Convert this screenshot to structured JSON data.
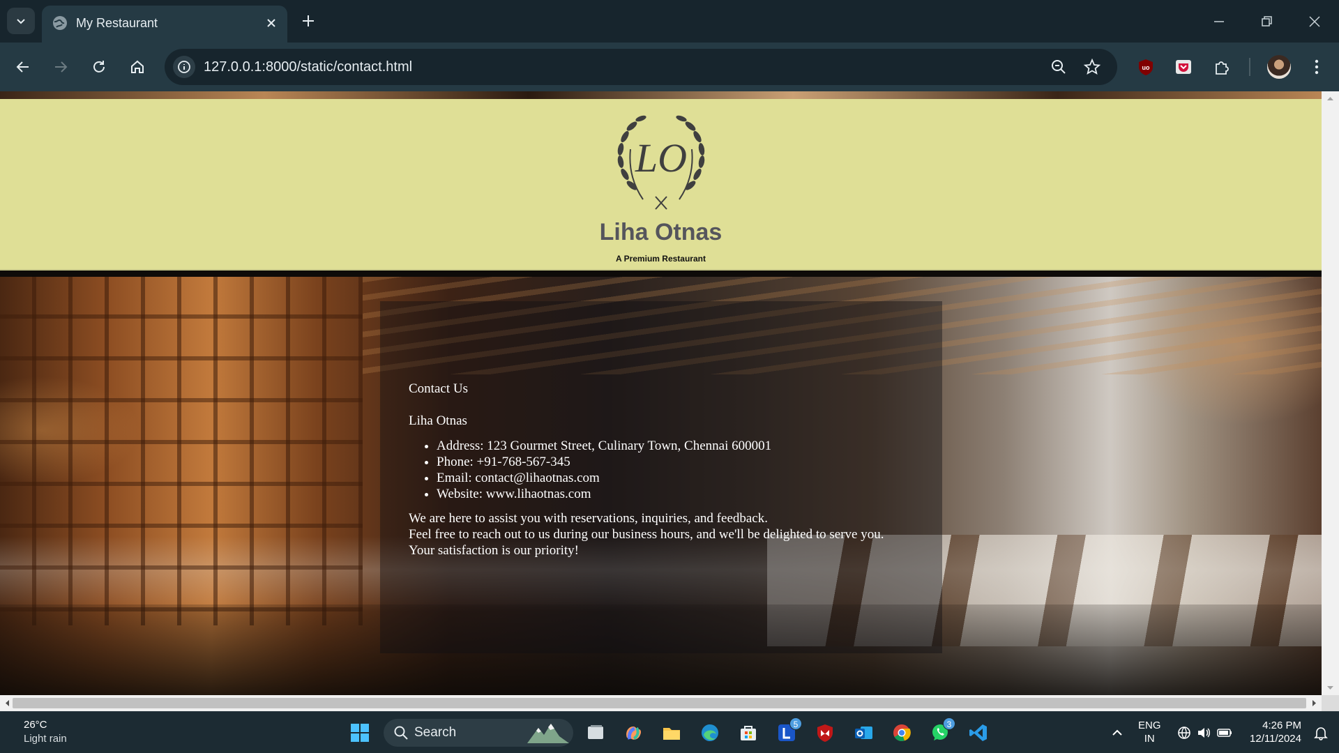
{
  "browser": {
    "tab_title": "My Restaurant",
    "url": "127.0.0.1:8000/static/contact.html"
  },
  "page": {
    "brand_name": "Liha Otnas",
    "logo_text": "LO",
    "tagline": "A Premium Restaurant",
    "contact": {
      "title": "Contact Us",
      "name": "Liha Otnas",
      "details": [
        "Address: 123 Gourmet Street, Culinary Town, Chennai 600001",
        "Phone: +91-768-567-345",
        "Email: contact@lihaotnas.com",
        "Website: www.lihaotnas.com"
      ],
      "message": [
        "We are here to assist you with reservations, inquiries, and feedback.",
        "Feel free to reach out to us during our business hours, and we'll be delighted to serve you.",
        "Your satisfaction is our priority!"
      ]
    }
  },
  "taskbar": {
    "weather_temp": "26°C",
    "weather_condition": "Light rain",
    "search_label": "Search",
    "badges": {
      "l_app": "5",
      "whatsapp": "3"
    },
    "language": "ENG",
    "region": "IN",
    "time": "4:26 PM",
    "date": "12/11/2024"
  },
  "colors": {
    "header_bg": "#dfdf96",
    "brand_text": "#55555c",
    "chrome_dark": "#17252d",
    "chrome_toolbar": "#253a44"
  }
}
